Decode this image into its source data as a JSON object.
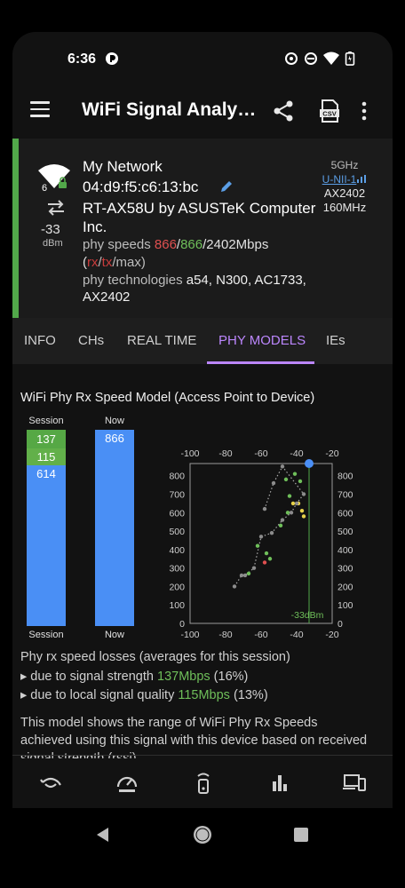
{
  "status_bar": {
    "time": "6:36",
    "icons": [
      "notification-icon",
      "sync-icon",
      "dnd-icon",
      "wifi-icon",
      "battery-icon"
    ]
  },
  "app_bar": {
    "title": "WiFi Signal Analy…",
    "icons": [
      "menu-icon",
      "share-icon",
      "csv-icon",
      "more-vert-icon"
    ]
  },
  "network": {
    "ssid": "My Network",
    "bssid": "04:d9:f5:c6:13:bc",
    "vendor": "RT-AX58U by ASUSTeK Computer Inc.",
    "rssi": "-33",
    "rssi_unit": "dBm",
    "wifi_generation": "6",
    "speeds_prefix": "phy speeds ",
    "speed_rx": "866",
    "slash1": "/",
    "speed_tx": "866",
    "speed_max_text": "/2402Mbps (",
    "legend_rx": "rx",
    "slash2": "/",
    "legend_tx": "tx",
    "legend_max": "/max)",
    "technologies_prefix": "phy technologies ",
    "technologies": "a54, N300, AC1733, AX2402",
    "band": "5GHz",
    "band_channel": "U-NII-1",
    "standard": "AX2402",
    "width": "160MHz",
    "colors": {
      "accent": "#52a84a",
      "rx": "#e05050",
      "tx": "#6fbf5a",
      "link": "#5b9ee6"
    }
  },
  "tabs": [
    {
      "label": "INFO",
      "active": false
    },
    {
      "label": "CHs",
      "active": false
    },
    {
      "label": "REAL TIME",
      "active": false
    },
    {
      "label": "PHY MODELS",
      "active": true
    },
    {
      "label": "IEs",
      "active": false
    }
  ],
  "model": {
    "title": "WiFi Phy Rx Speed Model (Access Point to Device)",
    "session_label": "Session",
    "now_label": "Now",
    "session_segments": [
      {
        "value": "137",
        "color": "#56a845"
      },
      {
        "value": "115",
        "color": "#62b04a"
      },
      {
        "value": "614",
        "color": "#4a8ff5"
      }
    ],
    "now_value": "866",
    "now_color": "#4a8ff5"
  },
  "chart_data": {
    "type": "scatter",
    "x_ticks": [
      "-100",
      "-80",
      "-60",
      "-40",
      "-20"
    ],
    "y_ticks": [
      "0",
      "100",
      "200",
      "300",
      "400",
      "500",
      "600",
      "700",
      "800"
    ],
    "xlim": [
      -100,
      -20
    ],
    "ylim": [
      0,
      866
    ],
    "marker_label": "-33dBm",
    "marker_x": -33,
    "series": [
      {
        "color": "#e05050",
        "x": [
          -58
        ],
        "y": [
          330
        ]
      },
      {
        "color": "#6fbf5a",
        "x": [
          -67,
          -62,
          -57,
          -55,
          -49,
          -45,
          -44,
          -46,
          -41,
          -38
        ],
        "y": [
          270,
          420,
          380,
          350,
          530,
          600,
          690,
          780,
          810,
          770
        ]
      },
      {
        "color": "#e8d24a",
        "x": [
          -42,
          -39,
          -37,
          -36
        ],
        "y": [
          650,
          650,
          610,
          580
        ]
      },
      {
        "color": "#4a8ff5",
        "x": [
          -33
        ],
        "y": [
          866
        ]
      },
      {
        "color": "#8c8c8c",
        "x": [
          -75,
          -71,
          -69,
          -64,
          -60,
          -54,
          -48,
          -43,
          -40,
          -36,
          -48,
          -53,
          -58
        ],
        "y": [
          200,
          260,
          260,
          300,
          470,
          490,
          560,
          600,
          650,
          700,
          850,
          760,
          620
        ]
      }
    ]
  },
  "losses": {
    "title": "Phy rx speed losses (averages for this session)",
    "signal_prefix": "▸ due to signal strength ",
    "signal_value": "137Mbps",
    "signal_pct": " (16%)",
    "quality_prefix": "▸ due to local signal quality ",
    "quality_value": "115Mbps",
    "quality_pct": " (13%)"
  },
  "description": "This model shows the range of WiFi Phy Rx Speeds achieved using this signal with this device based on received signal strength (rssi).",
  "bottom_nav": [
    "wifi-link-icon",
    "speedometer-icon",
    "router-icon",
    "bar-chart-icon",
    "devices-icon"
  ],
  "system_nav": [
    "back-icon",
    "home-icon",
    "recents-icon"
  ]
}
